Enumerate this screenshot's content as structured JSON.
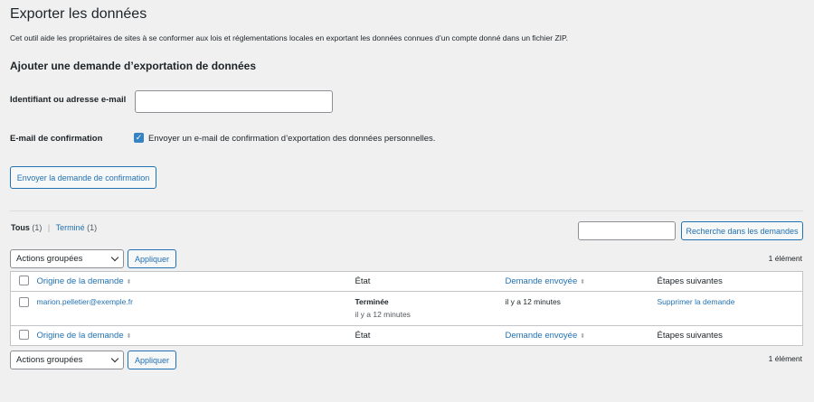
{
  "page": {
    "title": "Exporter les données",
    "description": "Cet outil aide les propriétaires de sites à se conformer aux lois et réglementations locales en exportant les données connues d’un compte donné dans un fichier ZIP."
  },
  "form": {
    "section_title": "Ajouter une demande d’exportation de données",
    "identifier_label": "Identifiant ou adresse e-mail",
    "identifier_value": "",
    "confirmation_label": "E-mail de confirmation",
    "confirmation_checkbox_label": "Envoyer un e-mail de confirmation d’exportation des données personnelles.",
    "confirmation_checked": true,
    "submit_label": "Envoyer la demande de confirmation"
  },
  "views": {
    "all_label": "Tous",
    "all_count": "(1)",
    "completed_label": "Terminé",
    "completed_count": "(1)"
  },
  "search": {
    "value": "",
    "button_label": "Recherche dans les demandes"
  },
  "bulk": {
    "top_select": "Actions groupées",
    "top_apply": "Appliquer",
    "bottom_select": "Actions groupées",
    "bottom_apply": "Appliquer",
    "count_top": "1 élément",
    "count_bottom": "1 élément"
  },
  "table": {
    "columns": {
      "origin": "Origine de la demande",
      "state": "État",
      "sent": "Demande envoyée",
      "next": "Étapes suivantes"
    },
    "rows": [
      {
        "email": "marion.pelletier@exemple.fr",
        "state": "Terminée",
        "state_time": "il y a 12 minutes",
        "sent": "il y a 12 minutes",
        "action": "Supprimer la demande"
      }
    ]
  },
  "colors": {
    "accent": "#2271b1",
    "checkbox": "#3582c4",
    "background": "#f0f0f1"
  }
}
